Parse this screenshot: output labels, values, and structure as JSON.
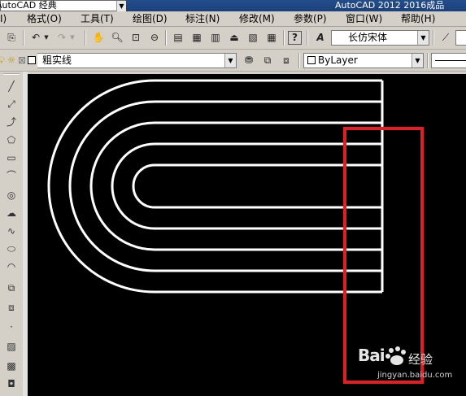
{
  "titlebar": {
    "workspace_text": "AutoCAD 经典",
    "title_text": "AutoCAD 2012    2016成品"
  },
  "menubar": {
    "items": [
      {
        "label": "I)"
      },
      {
        "label": "格式(O)"
      },
      {
        "label": "工具(T)"
      },
      {
        "label": "绘图(D)"
      },
      {
        "label": "标注(N)"
      },
      {
        "label": "修改(M)"
      },
      {
        "label": "参数(P)"
      },
      {
        "label": "窗口(W)"
      },
      {
        "label": "帮助(H)"
      }
    ]
  },
  "toolbar1": {
    "text_style_value": "长仿宋体",
    "icons": [
      "publish-icon",
      "undo-icon",
      "redo-icon",
      "pan-icon",
      "zoom-realtime-icon",
      "zoom-window-icon",
      "zoom-previous-icon",
      "properties-icon",
      "design-center-icon",
      "tool-palettes-icon",
      "sheet-set-icon",
      "markup-icon",
      "quickcalc-icon",
      "help-icon",
      "text-style-icon",
      "dimension-style-icon"
    ]
  },
  "toolbar2": {
    "layer_value": "粗实线",
    "color_value": "ByLayer",
    "icons": [
      "lightbulb-icon",
      "sun-icon",
      "lock-icon",
      "layer-color-icon",
      "make-current-icon",
      "layer-previous-icon",
      "layer-states-icon"
    ]
  },
  "draw_toolbar": {
    "tools": [
      {
        "name": "line-icon",
        "glyph": "╱"
      },
      {
        "name": "construction-line-icon",
        "glyph": "⤢"
      },
      {
        "name": "polyline-icon",
        "glyph": "⤴"
      },
      {
        "name": "polygon-icon",
        "glyph": "⬠"
      },
      {
        "name": "rectangle-icon",
        "glyph": "▭"
      },
      {
        "name": "arc-icon",
        "glyph": "⌒"
      },
      {
        "name": "circle-icon",
        "glyph": "◎"
      },
      {
        "name": "revision-cloud-icon",
        "glyph": "☁"
      },
      {
        "name": "spline-icon",
        "glyph": "∿"
      },
      {
        "name": "ellipse-icon",
        "glyph": "⬭"
      },
      {
        "name": "ellipse-arc-icon",
        "glyph": "◠"
      },
      {
        "name": "insert-block-icon",
        "glyph": "⧉"
      },
      {
        "name": "make-block-icon",
        "glyph": "⧈"
      },
      {
        "name": "point-icon",
        "glyph": "·"
      },
      {
        "name": "hatch-icon",
        "glyph": "▨"
      },
      {
        "name": "gradient-icon",
        "glyph": "▩"
      },
      {
        "name": "region-icon",
        "glyph": "◘"
      }
    ]
  },
  "watermark": {
    "brand": "Bai",
    "jingyan": "经验",
    "url": "jingyan.baidu.com"
  },
  "colors": {
    "canvas_bg": "#000000",
    "drawing_lines": "#ffffff",
    "highlight_box": "#e01e25",
    "titlebar": "#1e4580"
  }
}
